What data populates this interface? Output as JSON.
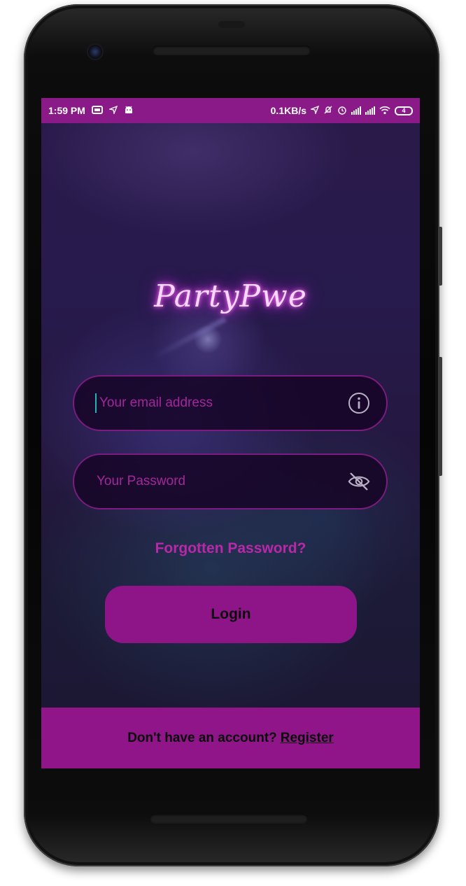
{
  "status_bar": {
    "time": "1:59 PM",
    "network_speed": "0.1KB/s",
    "battery_level": "4",
    "icons": [
      "sim-card-icon",
      "location-arrow-icon",
      "android-icon",
      "location-icon",
      "mute-icon",
      "alarm-icon",
      "signal-icon",
      "signal-icon",
      "wifi-icon",
      "battery-icon"
    ]
  },
  "app": {
    "logo_text": "PartyPwe"
  },
  "login_form": {
    "email_placeholder": "Your email address",
    "email_value": "",
    "email_icon": "info-icon",
    "password_placeholder": "Your Password",
    "password_value": "",
    "password_icon": "eye-off-icon",
    "forgot_password": "Forgotten Password?",
    "login_label": "Login"
  },
  "footer": {
    "prompt": "Don't have an account?",
    "register_label": "Register"
  },
  "colors": {
    "accent": "#8f1589",
    "status_bar": "#8a1a88",
    "link": "#b828a9",
    "field_border": "#7c1b80"
  }
}
